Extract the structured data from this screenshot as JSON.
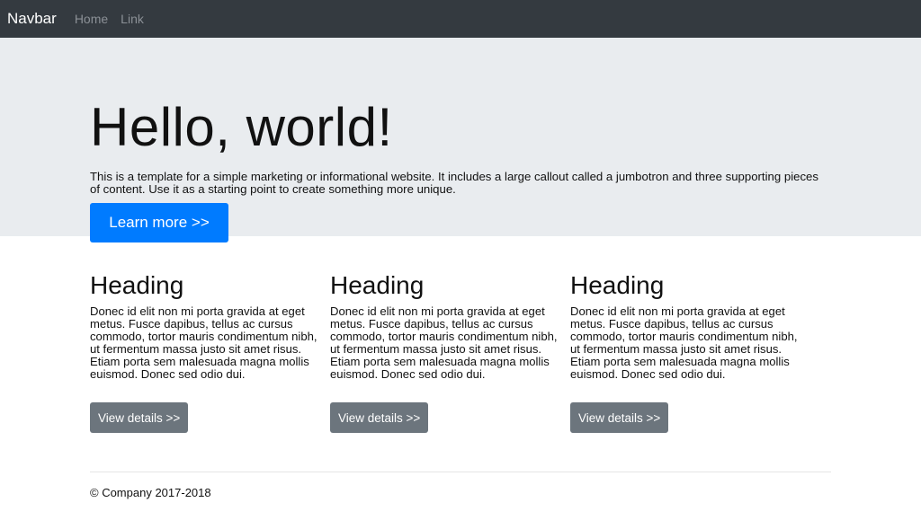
{
  "navbar": {
    "brand": "Navbar",
    "links": [
      "Home",
      "Link"
    ]
  },
  "jumbotron": {
    "title": "Hello, world!",
    "text": "This is a template for a simple marketing or informational website. It includes a large callout called a jumbotron and three supporting pieces of content. Use it as a starting point to create something more unique.",
    "button_label": "Learn more >>"
  },
  "features": [
    {
      "heading": "Heading",
      "body": "Donec id elit non mi porta gravida at eget metus. Fusce dapibus, tellus ac cursus commodo, tortor mauris condimentum nibh, ut fermentum massa justo sit amet risus. Etiam porta sem malesuada magna mollis euismod. Donec sed odio dui.",
      "button_label": "View details >>"
    },
    {
      "heading": "Heading",
      "body": "Donec id elit non mi porta gravida at eget metus. Fusce dapibus, tellus ac cursus commodo, tortor mauris condimentum nibh, ut fermentum massa justo sit amet risus. Etiam porta sem malesuada magna mollis euismod. Donec sed odio dui.",
      "button_label": "View details >>"
    },
    {
      "heading": "Heading",
      "body": "Donec id elit non mi porta gravida at eget metus. Fusce dapibus, tellus ac cursus commodo, tortor mauris condimentum nibh, ut fermentum massa justo sit amet risus. Etiam porta sem malesuada magna mollis euismod. Donec sed odio dui.",
      "button_label": "View details >>"
    }
  ],
  "footer": {
    "text": "© Company 2017-2018"
  },
  "colors": {
    "navbar_bg": "#343a40",
    "jumbotron_bg": "#e9ecef",
    "primary": "#007bff",
    "secondary": "#6c757d"
  }
}
